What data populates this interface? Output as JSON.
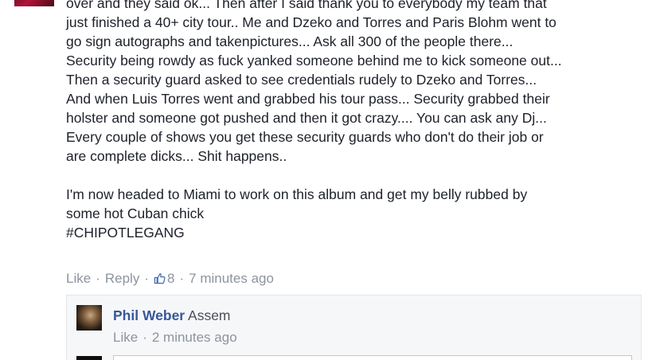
{
  "comment": {
    "lines": [
      "over and they said ok... Then after I said thank you to everybody my team that",
      "just finished a 40+ city tour.. Me and Dzeko and Torres and Paris Blohm went to",
      "go sign autographs and takenpictures... Ask all 300 of the people there...",
      "Security being rowdy as fuck yanked someone behind me to kick someone out...",
      "Then a security guard asked to see credentials rudely to Dzeko and Torres...",
      "And when Luis Torres went and grabbed his tour pass... Security grabbed their",
      "holster and someone got pushed and then it got crazy.... You can ask any Dj...",
      "Every couple of shows you get these security guards who don't do their job or",
      "are complete dicks... Shit happens.."
    ],
    "paragraph2_lines": [
      "I'm now headed to Miami to work on this album and get my belly rubbed by",
      "some hot Cuban chick"
    ],
    "hashtag": "#CHIPOTLEGANG",
    "actions": {
      "like_label": "Like",
      "separator": "·",
      "reply_label": "Reply",
      "like_count": "8",
      "timestamp": "7 minutes ago"
    }
  },
  "reply": {
    "author": "Phil Weber",
    "text": "Assem",
    "actions": {
      "like_label": "Like",
      "separator": "·",
      "timestamp": "2 minutes ago"
    }
  },
  "icons": {
    "like_count_icon": "thumbs-up-icon"
  },
  "colors": {
    "text": "#1d2129",
    "meta": "#8d949e",
    "link": "#365899",
    "reply_bg": "#f6f7f9"
  }
}
